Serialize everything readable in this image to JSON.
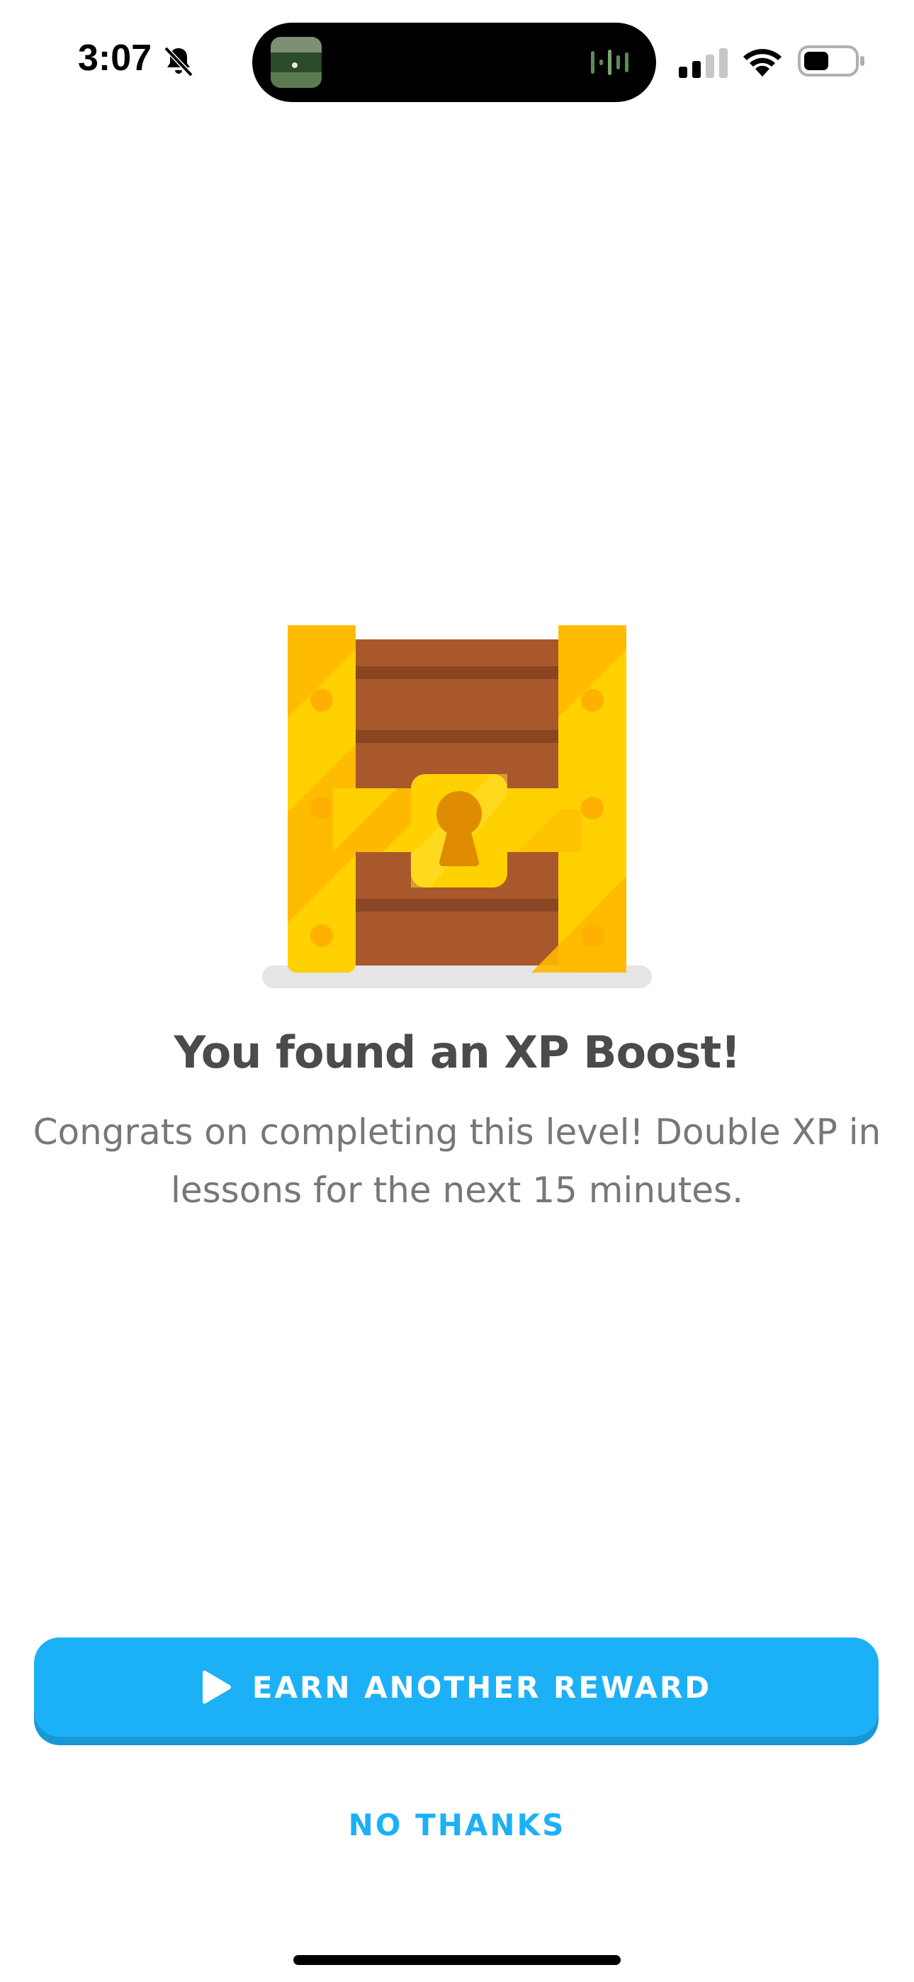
{
  "status_bar": {
    "time": "3:07",
    "icons": [
      "bell-slash-icon",
      "signal-icon",
      "wifi-icon",
      "battery-icon"
    ]
  },
  "dynamic_island": {
    "icons": [
      "now-playing-thumbnail",
      "audio-waveform-icon"
    ]
  },
  "reward": {
    "illustration": "treasure-chest",
    "title": "You found an XP Boost!",
    "subtitle": "Congrats on completing this level! Double XP in lessons for the next 15 minutes."
  },
  "actions": {
    "earn_another_label": "EARN ANOTHER REWARD",
    "earn_another_icon": "play-icon",
    "no_thanks_label": "NO THANKS"
  },
  "colors": {
    "primary": "#1cb0f6",
    "primary_shadow": "#1899d6",
    "title_text": "#4b4b4b",
    "body_text": "#777777",
    "chest_gold": "#ffd100",
    "chest_gold_dark": "#ffb800",
    "chest_wood": "#a9582b"
  }
}
